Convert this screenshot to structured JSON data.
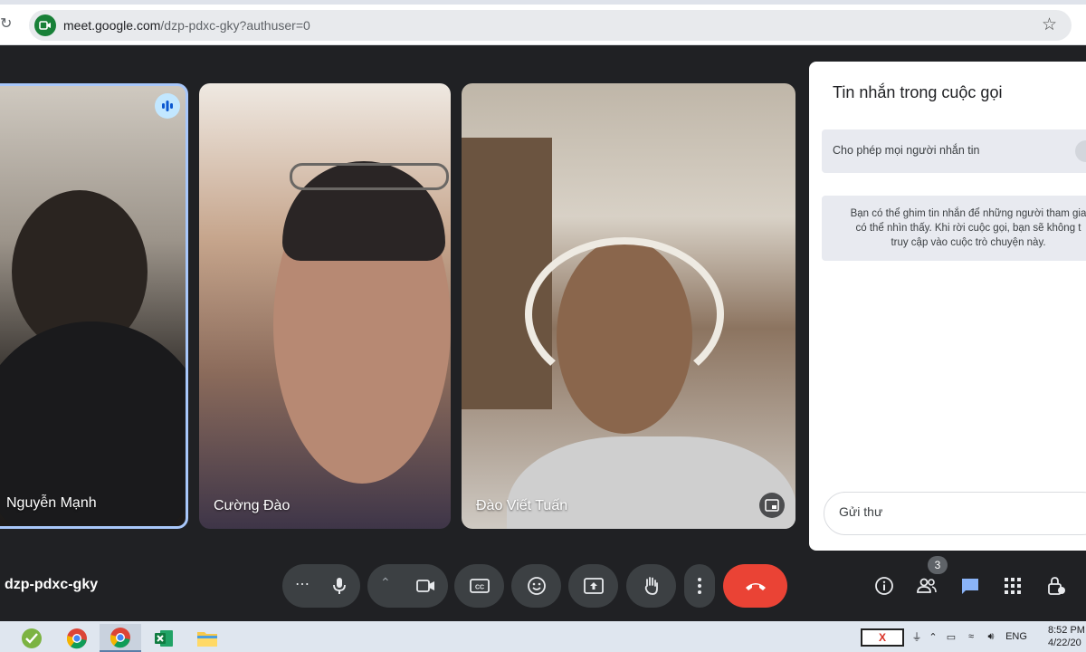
{
  "browser": {
    "url_host": "meet.google.com",
    "url_path": "/dzp-pdxc-gky?authuser=0"
  },
  "participants": [
    {
      "name": "Nguyễn Mạnh",
      "speaking": true
    },
    {
      "name": "Cường Đào",
      "speaking": false
    },
    {
      "name": "Đào Viết Tuấn",
      "speaking": false
    }
  ],
  "chat_panel": {
    "title": "Tin nhắn trong cuộc gọi",
    "toggle_label": "Cho phép mọi người nhắn tin",
    "info_line1": "Bạn có thể ghim tin nhắn để những người tham gia",
    "info_line2": "có thể nhìn thấy. Khi rời cuộc gọi, bạn sẽ không t",
    "info_line3": "truy cập vào cuộc trò chuyện này.",
    "input_placeholder": "Gửi thư"
  },
  "controls": {
    "meeting_code": "dzp-pdxc-gky",
    "more_audio_label": "⋯",
    "people_count": "3"
  },
  "taskbar": {
    "warning_label": "X",
    "language": "ENG",
    "time": "8:52 PM",
    "date": "4/22/20"
  },
  "colors": {
    "background": "#202124",
    "accent": "#a8c7fa",
    "end_call": "#ea4335",
    "chat_icon": "#8ab4f8"
  }
}
